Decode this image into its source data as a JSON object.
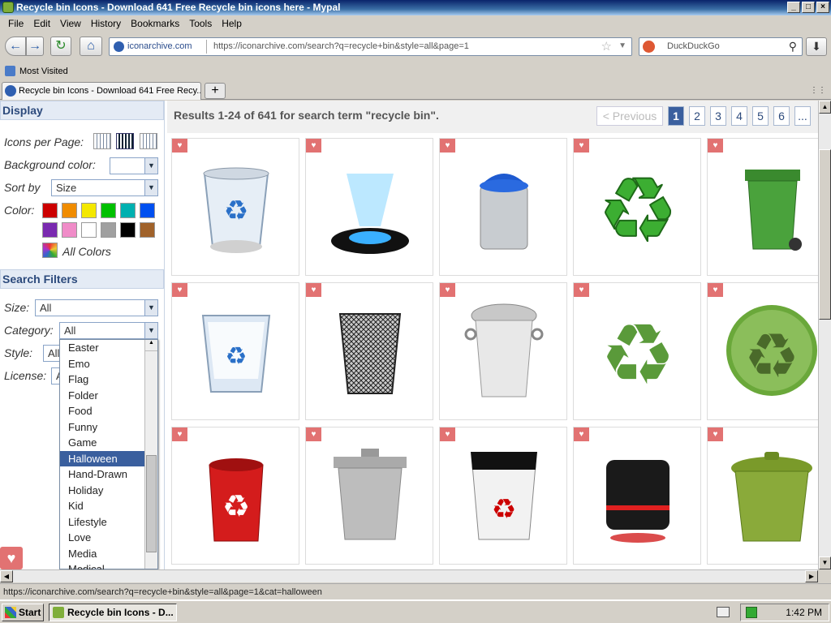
{
  "window": {
    "title": "Recycle bin Icons - Download 641 Free Recycle bin icons here - Mypal",
    "controls": [
      "_",
      "□",
      "×"
    ]
  },
  "menu": [
    "File",
    "Edit",
    "View",
    "History",
    "Bookmarks",
    "Tools",
    "Help"
  ],
  "nav": {
    "site_identity": "iconarchive.com",
    "url": "https://iconarchive.com/search?q=recycle+bin&style=all&page=1",
    "search_placeholder": "DuckDuckGo"
  },
  "bookmarks": {
    "most_visited": "Most Visited"
  },
  "tab": {
    "title": "Recycle bin Icons - Download 641 Free Recy...",
    "new_tab": "+"
  },
  "sidebar": {
    "display_header": "Display",
    "icons_per_page_label": "Icons per Page:",
    "background_color_label": "Background color:",
    "sort_by_label": "Sort by",
    "sort_by_value": "Size",
    "color_label": "Color:",
    "colors": [
      "#cc0000",
      "#f08c00",
      "#f4e800",
      "#00c000",
      "#00b0b0",
      "#0050f0",
      "#7a2ab0",
      "#f08cc8",
      "#ffffff",
      "#a0a0a0",
      "#000000",
      "#a0622a"
    ],
    "all_colors": "All Colors",
    "filters_header": "Search Filters",
    "size_label": "Size:",
    "size_value": "All",
    "category_label": "Category:",
    "category_value": "All",
    "style_label": "Style:",
    "style_value": "All",
    "license_label": "License:",
    "license_value": "All"
  },
  "category_dropdown": {
    "items": [
      "Easter",
      "Emo",
      "Flag",
      "Folder",
      "Food",
      "Funny",
      "Game",
      "Halloween",
      "Hand-Drawn",
      "Holiday",
      "Kid",
      "Lifestyle",
      "Love",
      "Media",
      "Medical"
    ],
    "selected": "Halloween"
  },
  "results": {
    "summary": "Results 1-24 of 641 for search term \"recycle bin\".",
    "previous": "< Previous",
    "pages": [
      "1",
      "2",
      "3",
      "4",
      "5",
      "6",
      "..."
    ],
    "current_page": "1"
  },
  "icons": [
    "recycle-bin-glass-icon",
    "hologram-bin-icon",
    "blue-lid-bin-icon",
    "green-recycle-symbol-icon",
    "green-wheelie-bin-icon",
    "full-glass-bin-icon",
    "mesh-bin-icon",
    "ornate-bin-icon",
    "flat-green-recycle-icon",
    "green-orb-recycle-icon",
    "red-bin-icon",
    "grey-bin-icon",
    "red-white-bin-icon",
    "black-cube-bin-icon",
    "olive-bin-icon"
  ],
  "status_url": "https://iconarchive.com/search?q=recycle+bin&style=all&page=1&cat=halloween",
  "taskbar": {
    "start": "Start",
    "task_item": "Recycle bin Icons - D...",
    "clock": "1:42 PM"
  }
}
